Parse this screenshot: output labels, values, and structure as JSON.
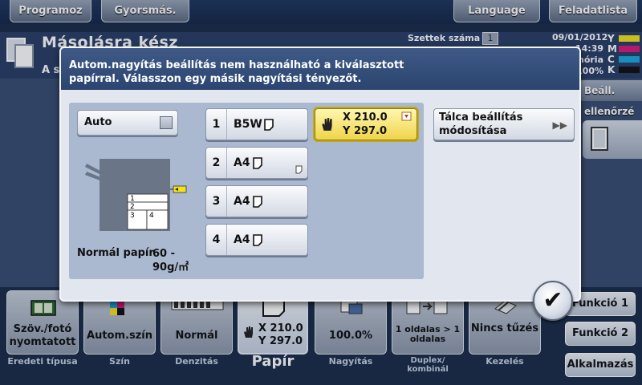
{
  "topbar": {
    "program": "Programoz",
    "quick": "Gyorsmás.",
    "language": "Language",
    "job_list": "Feladatlista"
  },
  "status": {
    "title": "Másolásra kész",
    "subtitle": "A sz",
    "set_count_label": "Szettek száma",
    "set_count_value": "1",
    "date": "09/01/2012",
    "time": "14:39",
    "memory_label": "Memória",
    "memory_value": "100%",
    "toner": [
      "Y",
      "M",
      "C",
      "K"
    ]
  },
  "right_panel": {
    "check_label": "Beáll. ellenőrzé"
  },
  "bottom_tiles": [
    {
      "label": "Szöv./fotó nyomtatott",
      "caption": "Eredeti típusa"
    },
    {
      "label": "Autom.szín",
      "caption": "Szín"
    },
    {
      "label": "Normál",
      "caption": "Denzitás"
    },
    {
      "label": "100.0%",
      "caption": "Nagyítás"
    },
    {
      "label": "1 oldalas > 1 oldalas",
      "caption": "Duplex/ kombinál"
    },
    {
      "label": "Nincs tűzés",
      "caption": "Kezelés"
    }
  ],
  "paper_tile": {
    "x": "X 210.0",
    "y": "Y 297.0",
    "caption": "Papír"
  },
  "function_buttons": {
    "f1": "Funkció 1",
    "f2": "Funkció 2",
    "app": "Alkalmazás"
  },
  "modal": {
    "message": "Autom.nagyítás beállítás nem használható a kiválasztott papírral. Válasszon egy másik nagyítási tényezőt.",
    "auto_label": "Auto",
    "trays": [
      {
        "num": "1",
        "size": "B5W"
      },
      {
        "num": "2",
        "size": "A4"
      },
      {
        "num": "3",
        "size": "A4"
      },
      {
        "num": "4",
        "size": "A4"
      }
    ],
    "selected": {
      "x": "X 210.0",
      "y": "Y 297.0"
    },
    "tray_settings_line1": "Tálca beállítás",
    "tray_settings_line2": "módosítása",
    "paper_type": "Normál papír",
    "paper_weight_line1": "60 -",
    "paper_weight_line2": "90g/㎡",
    "machine_trays": [
      "1",
      "2",
      "3",
      "4"
    ],
    "ok_symbol": "✔"
  },
  "colors": {
    "header_blue": "#2b4470",
    "panel": "#aab8d0",
    "selected_yellow": "#efd44a"
  }
}
